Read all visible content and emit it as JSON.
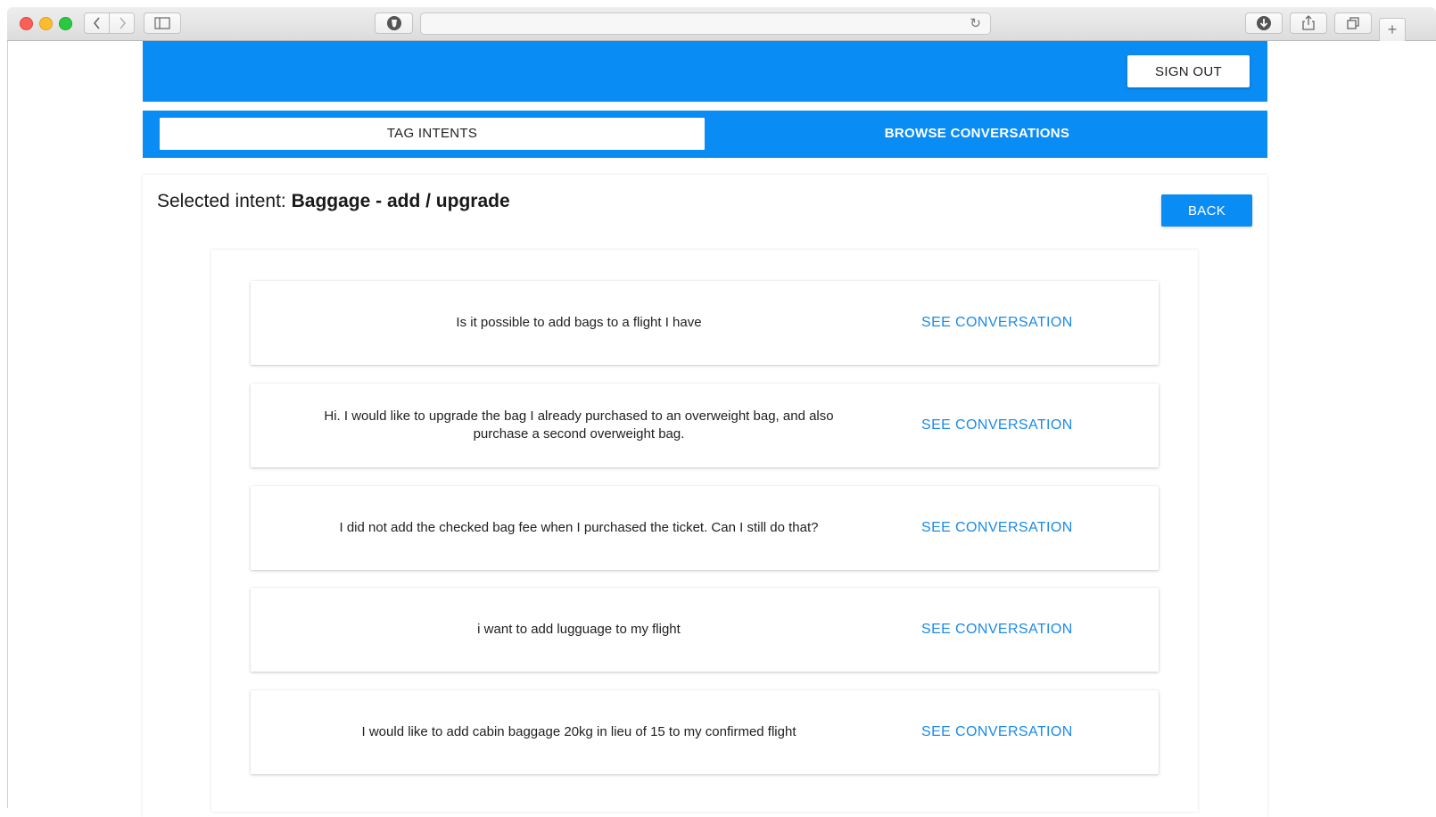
{
  "browser": {
    "nav_back_icon": "chevron-left-icon",
    "nav_forward_icon": "chevron-right-icon",
    "sidebar_icon": "sidebar-icon",
    "shield_icon": "shield-icon",
    "reload_icon": "reload-icon",
    "download_icon": "download-icon",
    "share_icon": "share-icon",
    "tabs_icon": "tabs-icon",
    "new_tab_icon": "plus-icon",
    "url": ""
  },
  "header": {
    "sign_out_label": "SIGN OUT",
    "accent_color": "#0a8cf5"
  },
  "tabs": [
    {
      "label": "TAG INTENTS",
      "active": true
    },
    {
      "label": "BROWSE CONVERSATIONS",
      "active": false
    }
  ],
  "main": {
    "selected_prefix": "Selected intent: ",
    "selected_intent": "Baggage - add / upgrade",
    "back_label": "BACK"
  },
  "utterances": [
    {
      "text": "Is it possible to add bags to a flight I have",
      "link": "SEE CONVERSATION"
    },
    {
      "text": "Hi. I would like to upgrade the bag I already purchased to an overweight bag, and also purchase a second overweight bag.",
      "link": "SEE CONVERSATION"
    },
    {
      "text": "I did not add the checked bag fee when I purchased the ticket. Can I still do that?",
      "link": "SEE CONVERSATION"
    },
    {
      "text": "i want to add lugguage to my flight",
      "link": "SEE CONVERSATION"
    },
    {
      "text": "I would like to add cabin baggage 20kg in lieu of 15 to my confirmed flight",
      "link": "SEE CONVERSATION"
    }
  ]
}
